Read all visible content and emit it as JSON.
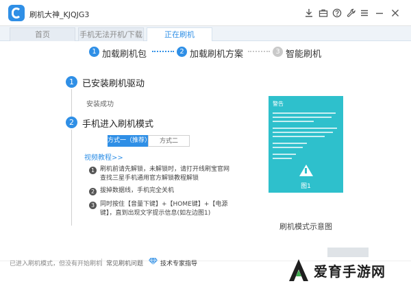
{
  "app": {
    "title": "刷机大神_KJQJG3"
  },
  "tabs": [
    {
      "label": "首页"
    },
    {
      "label": "手机无法开机/下载"
    },
    {
      "label": "正在刷机"
    }
  ],
  "steps": [
    {
      "num": "1",
      "label": "加载刷机包",
      "state": "active"
    },
    {
      "num": "2",
      "label": "加载刷机方案",
      "state": "active"
    },
    {
      "num": "3",
      "label": "智能刷机",
      "state": "pending"
    }
  ],
  "section1": {
    "num": "1",
    "title": "已安装刷机驱动",
    "status": "安装成功"
  },
  "section2": {
    "num": "2",
    "title": "手机进入刷机模式",
    "methods": [
      "方式一（推荐）",
      "方式二"
    ],
    "video_link": "视频教程>>",
    "instructions": [
      {
        "num": "1",
        "text": "刷机前请先解锁，未解锁时，请打开线刷宝官网查找三星手机通用官方解锁教程解锁"
      },
      {
        "num": "2",
        "text": "拔掉数据线，手机完全关机"
      },
      {
        "num": "3",
        "text": "同时按住【音量下键】+【HOME键】+【电源键】，直到出现文字提示信息(如左边图1)"
      }
    ]
  },
  "preview": {
    "screen_title": "警告",
    "screen_caption": "图1",
    "caption": "刷机模式示意图"
  },
  "status_bar": {
    "left_text": "已进入刷机模式，但没有开始刷机",
    "help_link": "常见刷机问题",
    "expert_label": "技术专家指导"
  },
  "watermark": {
    "text": "爱育手游网"
  },
  "colors": {
    "accent": "#2f8fe6",
    "screen": "#2ec0cc"
  }
}
